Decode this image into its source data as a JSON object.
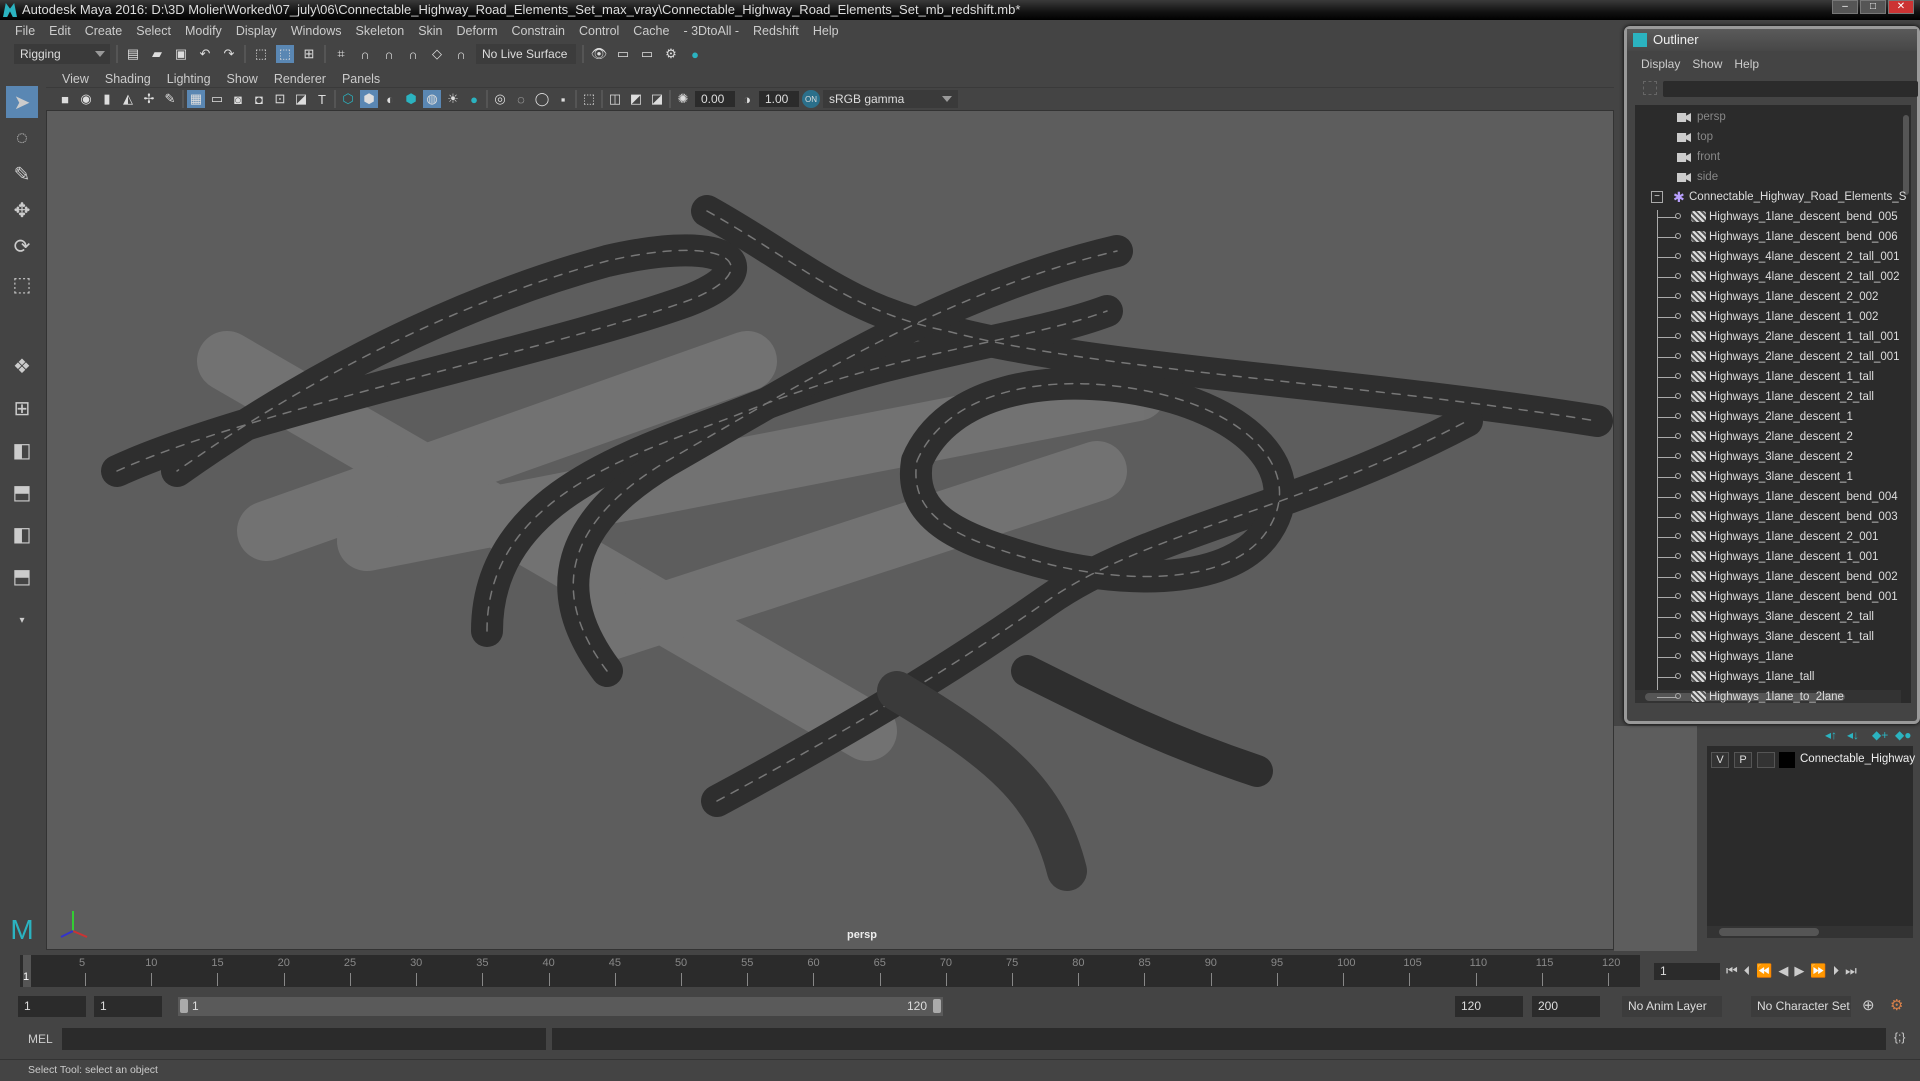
{
  "window": {
    "title": "Autodesk Maya 2016: D:\\3D Molier\\Worked\\07_july\\06\\Connectable_Highway_Road_Elements_Set_max_vray\\Connectable_Highway_Road_Elements_Set_mb_redshift.mb*",
    "min": "–",
    "max": "□",
    "close": "✕"
  },
  "menu": [
    "File",
    "Edit",
    "Create",
    "Select",
    "Modify",
    "Display",
    "Windows",
    "Skeleton",
    "Skin",
    "Deform",
    "Constrain",
    "Control",
    "Cache",
    "- 3DtoAll -",
    "Redshift",
    "Help"
  ],
  "shelf": {
    "mode": "Rigging",
    "live_surface": "No Live Surface"
  },
  "panel": {
    "menu": [
      "View",
      "Shading",
      "Lighting",
      "Show",
      "Renderer",
      "Panels"
    ],
    "exposure": "0.00",
    "gamma": "1.00",
    "color_space": "sRGB gamma",
    "color_mgmt": "ON",
    "camera": "persp"
  },
  "timeline": {
    "ticks": [
      5,
      10,
      15,
      20,
      25,
      30,
      35,
      40,
      45,
      50,
      55,
      60,
      65,
      70,
      75,
      80,
      85,
      90,
      95,
      100,
      105,
      110,
      115,
      120
    ],
    "current_frame": "1",
    "min": 1,
    "max": 120
  },
  "playback": {
    "current": "1"
  },
  "range": {
    "start": "1",
    "anim_start": "1",
    "slider_start": "1",
    "slider_end": "120",
    "end": "120",
    "anim_end": "200",
    "anim_layer": "No Anim Layer",
    "char_set": "No Character Set"
  },
  "mel": {
    "label": "MEL"
  },
  "status": "Select Tool: select an object",
  "outliner": {
    "title": "Outliner",
    "menu": [
      "Display",
      "Show",
      "Help"
    ],
    "cameras": [
      "persp",
      "top",
      "front",
      "side"
    ],
    "group": "Connectable_Highway_Road_Elements_S",
    "children": [
      "Highways_1lane_descent_bend_005",
      "Highways_1lane_descent_bend_006",
      "Highways_4lane_descent_2_tall_001",
      "Highways_4lane_descent_2_tall_002",
      "Highways_1lane_descent_2_002",
      "Highways_1lane_descent_1_002",
      "Highways_2lane_descent_1_tall_001",
      "Highways_2lane_descent_2_tall_001",
      "Highways_1lane_descent_1_tall",
      "Highways_1lane_descent_2_tall",
      "Highways_2lane_descent_1",
      "Highways_2lane_descent_2",
      "Highways_3lane_descent_2",
      "Highways_3lane_descent_1",
      "Highways_1lane_descent_bend_004",
      "Highways_1lane_descent_bend_003",
      "Highways_1lane_descent_2_001",
      "Highways_1lane_descent_1_001",
      "Highways_1lane_descent_bend_002",
      "Highways_1lane_descent_bend_001",
      "Highways_3lane_descent_2_tall",
      "Highways_3lane_descent_1_tall",
      "Highways_1lane",
      "Highways_1lane_tall",
      "Highways_1lane_to_2lane"
    ]
  },
  "layers": {
    "v": "V",
    "p": "P",
    "name": "Connectable_Highway"
  }
}
